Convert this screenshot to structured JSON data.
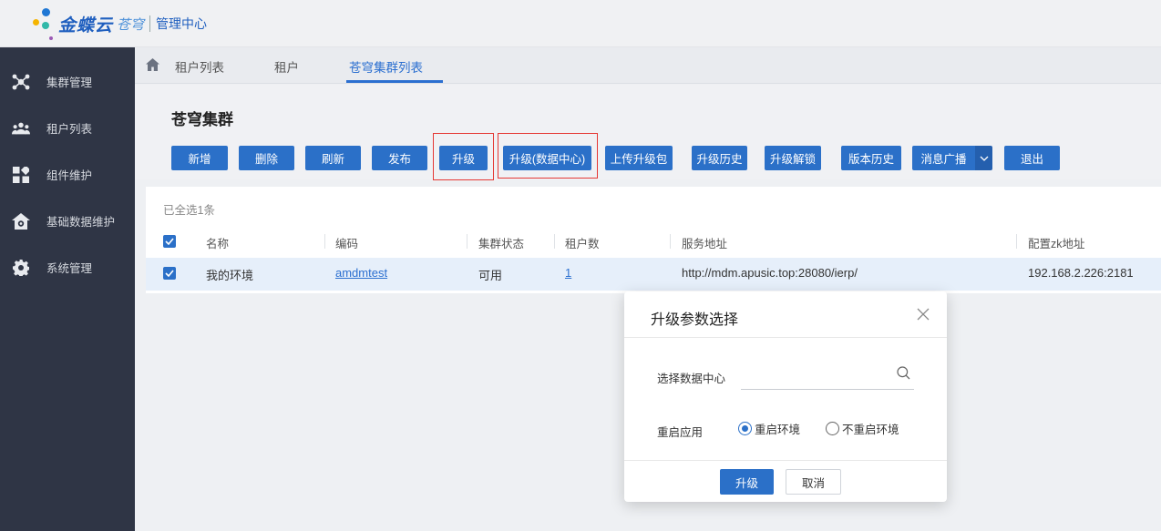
{
  "app": {
    "brand": "金蝶云",
    "brand_sub": "苍穹",
    "module": "管理中心"
  },
  "sidebar": {
    "items": [
      {
        "label": "集群管理",
        "icon": "cluster-icon"
      },
      {
        "label": "租户列表",
        "icon": "users-icon"
      },
      {
        "label": "组件维护",
        "icon": "grid-icon"
      },
      {
        "label": "基础数据维护",
        "icon": "house-gear-icon"
      },
      {
        "label": "系统管理",
        "icon": "gear-icon"
      }
    ]
  },
  "tabs": [
    {
      "label": "租户列表"
    },
    {
      "label": "租户"
    },
    {
      "label": "苍穹集群列表",
      "active": true
    }
  ],
  "page": {
    "title": "苍穹集群"
  },
  "toolbar": {
    "buttons": [
      "新增",
      "删除",
      "刷新",
      "发布",
      "升级",
      "升级(数据中心)",
      "上传升级包",
      "升级历史",
      "升级解锁",
      "版本历史",
      "消息广播",
      "退出"
    ]
  },
  "table": {
    "selection_text": "已全选1条",
    "columns": [
      "名称",
      "编码",
      "集群状态",
      "租户数",
      "服务地址",
      "配置zk地址"
    ],
    "rows": [
      {
        "name": "我的环境",
        "code": "amdmtest",
        "status": "可用",
        "tenants": "1",
        "service_url": "http://mdm.apusic.top:28080/ierp/",
        "zk": "192.168.2.226:2181"
      }
    ]
  },
  "dialog": {
    "title": "升级参数选择",
    "datacenter_label": "选择数据中心",
    "datacenter_value": "",
    "restart_label": "重启应用",
    "options": [
      "重启环境",
      "不重启环境"
    ],
    "selected_option": "重启环境",
    "ok_label": "升级",
    "cancel_label": "取消"
  },
  "colors": {
    "primary": "#2b70c8",
    "sidebar_bg": "#2f3545",
    "highlight": "#e53935"
  }
}
